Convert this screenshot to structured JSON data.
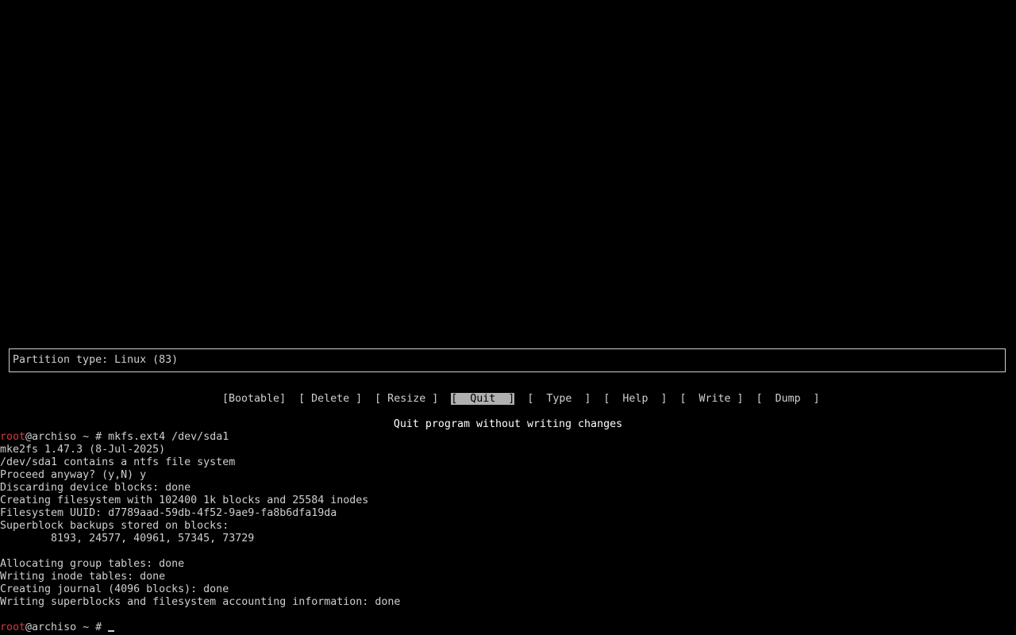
{
  "cfdisk": {
    "partition_type": "Partition type: Linux (83)",
    "menu": [
      {
        "label": "[Bootable]",
        "selected": false
      },
      {
        "label": "[ Delete ]",
        "selected": false
      },
      {
        "label": "[ Resize ]",
        "selected": false
      },
      {
        "label": "[  Quit  ]",
        "selected": true
      },
      {
        "label": "[  Type  ]",
        "selected": false
      },
      {
        "label": "[  Help  ]",
        "selected": false
      },
      {
        "label": "[  Write ]",
        "selected": false
      },
      {
        "label": "[  Dump  ]",
        "selected": false
      }
    ],
    "hint": "Quit program without writing changes"
  },
  "terminal": {
    "prompt_user": "root",
    "prompt_rest": "@archiso ~ # ",
    "command": "mkfs.ext4 /dev/sda1",
    "output": [
      "mke2fs 1.47.3 (8-Jul-2025)",
      "/dev/sda1 contains a ntfs file system",
      "Proceed anyway? (y,N) y",
      "Discarding device blocks: done",
      "Creating filesystem with 102400 1k blocks and 25584 inodes",
      "Filesystem UUID: d7789aad-59db-4f52-9ae9-fa8b6dfa19da",
      "Superblock backups stored on blocks:",
      "        8193, 24577, 40961, 57345, 73729",
      "",
      "Allocating group tables: done",
      "Writing inode tables: done",
      "Creating journal (4096 blocks): done",
      "Writing superblocks and filesystem accounting information: done",
      ""
    ],
    "final_prompt_user": "root",
    "final_prompt_rest": "@archiso ~ # "
  }
}
